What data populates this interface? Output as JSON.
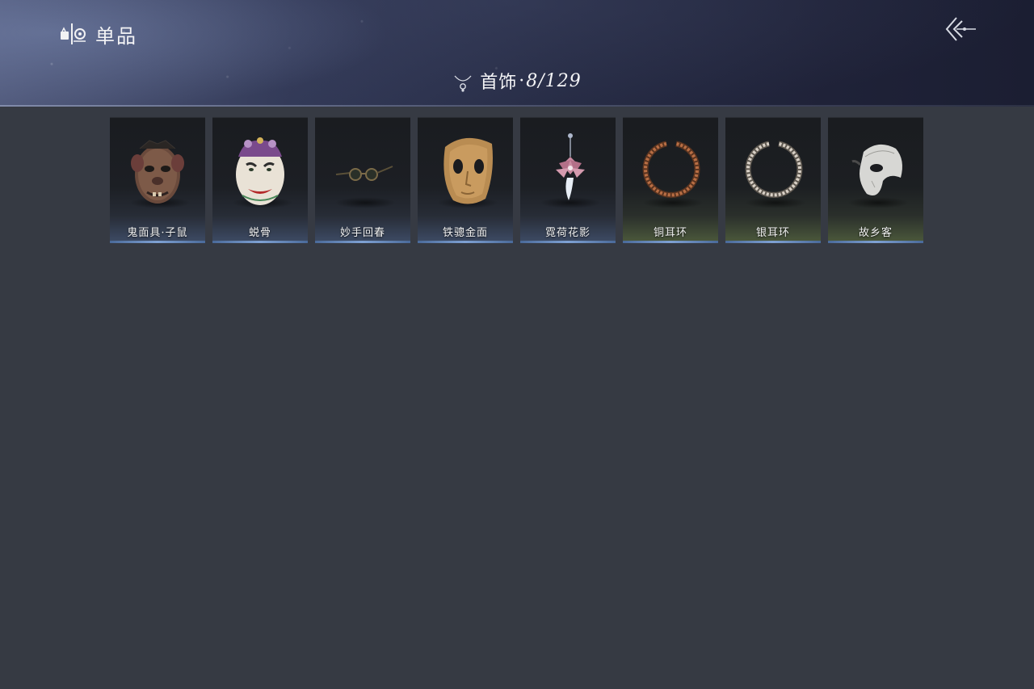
{
  "header": {
    "title": "单品",
    "category": {
      "label": "首饰",
      "separator": "·",
      "count": "8/129"
    }
  },
  "items": [
    {
      "name": "鬼面具·子鼠",
      "icon": "rat-mask-icon",
      "rarity_color": "#7fa1d3"
    },
    {
      "name": "蜕骨",
      "icon": "painted-mask-icon",
      "rarity_color": "#7fa1d3"
    },
    {
      "name": "妙手回春",
      "icon": "glasses-icon",
      "rarity_color": "#7fa1d3"
    },
    {
      "name": "铁骢金面",
      "icon": "gold-mask-icon",
      "rarity_color": "#7fa1d3"
    },
    {
      "name": "霓荷花影",
      "icon": "lotus-hairpin-icon",
      "rarity_color": "#7fa1d3"
    },
    {
      "name": "铜耳环",
      "icon": "copper-earring-icon",
      "rarity_color": "#6b8a4a"
    },
    {
      "name": "银耳环",
      "icon": "silver-earring-icon",
      "rarity_color": "#6b8a4a"
    },
    {
      "name": "故乡客",
      "icon": "half-mask-icon",
      "rarity_color": "#6b8a4a"
    }
  ]
}
